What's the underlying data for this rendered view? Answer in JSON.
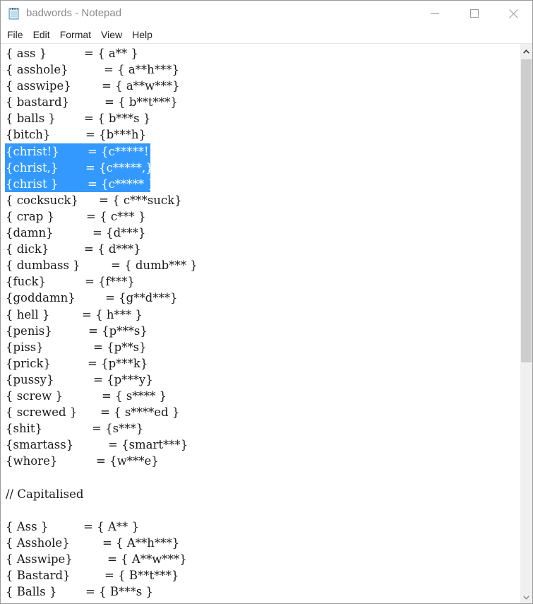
{
  "window": {
    "title": "badwords - Notepad",
    "controls": {
      "minimize": "minimize",
      "maximize": "maximize",
      "close": "close"
    }
  },
  "menubar": {
    "items": [
      "File",
      "Edit",
      "Format",
      "View",
      "Help"
    ]
  },
  "editor": {
    "lines": [
      {
        "key": "{ ass }",
        "value": "= { a** }",
        "selected": false
      },
      {
        "key": "{ asshole}",
        "value": "= { a**h***}",
        "selected": false
      },
      {
        "key": "{ asswipe}",
        "value": "= { a**w***}",
        "selected": false
      },
      {
        "key": "{ bastard}",
        "value": "= { b**t***}",
        "selected": false
      },
      {
        "key": "{ balls }",
        "value": "= { b***s }",
        "selected": false
      },
      {
        "key": "{bitch}",
        "value": "= {b***h}",
        "selected": false
      },
      {
        "key": "{christ!}",
        "value": "= {c*****!}",
        "selected": true
      },
      {
        "key": "{christ,}",
        "value": "= {c*****,}",
        "selected": true
      },
      {
        "key": "{christ }",
        "value": "= {c***** }",
        "selected": true
      },
      {
        "key": "{ cocksuck}",
        "value": "= { c***suck}",
        "selected": false
      },
      {
        "key": "{ crap }",
        "value": "= { c*** }",
        "selected": false
      },
      {
        "key": "{damn}",
        "value": "= {d***}",
        "selected": false
      },
      {
        "key": "{ dick}",
        "value": "= { d***}",
        "selected": false
      },
      {
        "key": "{ dumbass }",
        "value": "= { dumb*** }",
        "selected": false
      },
      {
        "key": "{fuck}",
        "value": "= {f***}",
        "selected": false
      },
      {
        "key": "{goddamn}",
        "value": "= {g**d***}",
        "selected": false
      },
      {
        "key": "{ hell }",
        "value": "= { h*** }",
        "selected": false
      },
      {
        "key": "{penis}",
        "value": "= {p***s}",
        "selected": false
      },
      {
        "key": "{piss}",
        "value": "= {p**s}",
        "selected": false
      },
      {
        "key": "{prick}",
        "value": "= {p***k}",
        "selected": false
      },
      {
        "key": "{pussy}",
        "value": "= {p***y}",
        "selected": false
      },
      {
        "key": "{ screw }",
        "value": "= { s**** }",
        "selected": false
      },
      {
        "key": "{ screwed }",
        "value": "= { s****ed }",
        "selected": false
      },
      {
        "key": "{shit}",
        "value": "= {s***}",
        "selected": false
      },
      {
        "key": "{smartass}",
        "value": "= {smart***}",
        "selected": false
      },
      {
        "key": "{whore}",
        "value": "= {w***e}",
        "selected": false
      },
      {
        "key": "",
        "value": "",
        "selected": false
      },
      {
        "key": "// Capitalised",
        "value": "",
        "selected": false
      },
      {
        "key": "",
        "value": "",
        "selected": false
      },
      {
        "key": "{ Ass }",
        "value": "= { A** }",
        "selected": false
      },
      {
        "key": "{ Asshole}",
        "value": "= { A**h***}",
        "selected": false
      },
      {
        "key": "{ Asswipe}",
        "value": "= { A**w***}",
        "selected": false
      },
      {
        "key": "{ Bastard}",
        "value": "= { B**t***}",
        "selected": false
      },
      {
        "key": "{ Balls }",
        "value": "= { B***s }",
        "selected": false
      }
    ]
  },
  "scrollbar": {
    "position_fraction": 0.0,
    "visible_fraction": 0.57
  },
  "colors": {
    "selection": "#3399ff",
    "selection_text": "#ffffff",
    "text": "#1a1a1a",
    "scroll_thumb": "#cdcdcd",
    "scroll_track": "#f0f0f0"
  }
}
